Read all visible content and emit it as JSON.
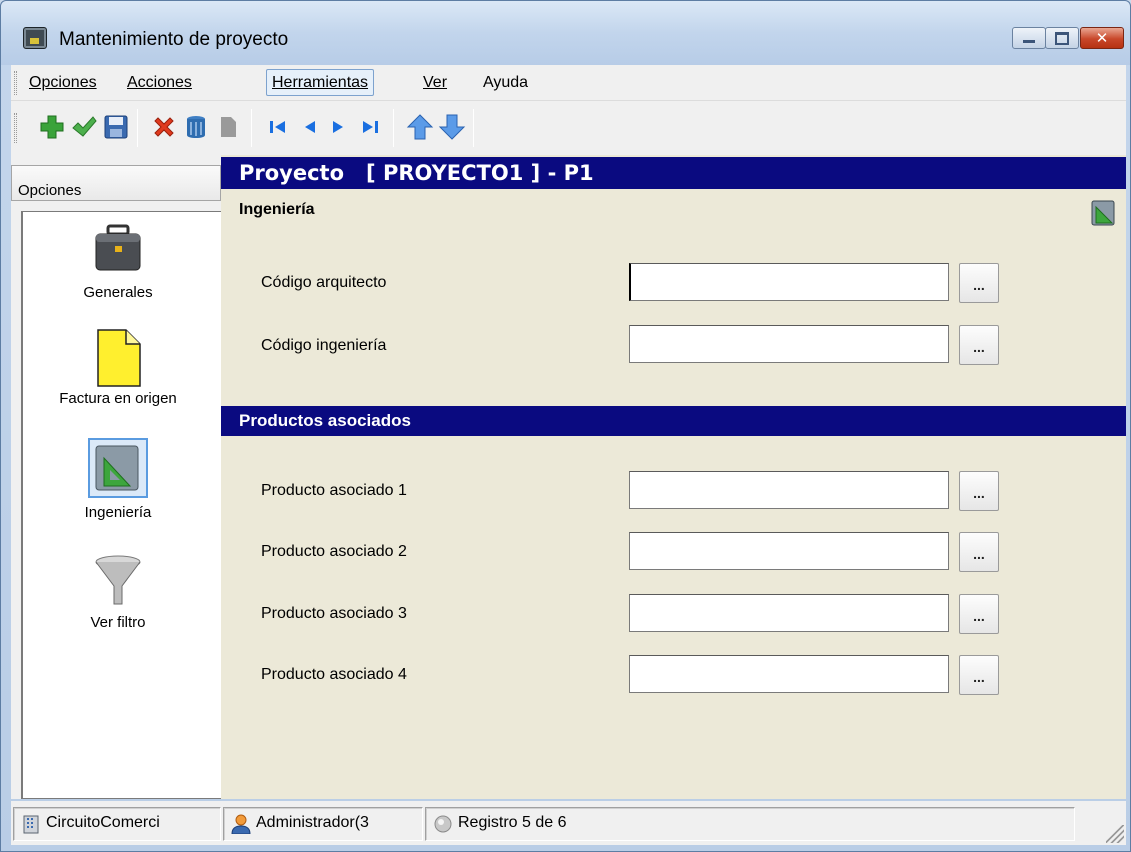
{
  "window": {
    "title": "Mantenimiento de proyecto"
  },
  "menu": {
    "items": [
      {
        "label": "Opciones"
      },
      {
        "label": "Acciones"
      },
      {
        "label": "Herramientas",
        "active": true
      },
      {
        "label": "Ver"
      },
      {
        "label": "Ayuda"
      }
    ]
  },
  "toolbar": {
    "buttons": [
      {
        "icon": "add-icon"
      },
      {
        "icon": "check-icon"
      },
      {
        "icon": "save-icon"
      },
      {
        "icon": "delete-icon"
      },
      {
        "icon": "trash-icon"
      },
      {
        "icon": "disabled-icon"
      },
      {
        "icon": "first-record-icon"
      },
      {
        "icon": "previous-record-icon"
      },
      {
        "icon": "next-record-icon"
      },
      {
        "icon": "last-record-icon"
      },
      {
        "icon": "move-up-icon"
      },
      {
        "icon": "move-down-icon"
      }
    ]
  },
  "sidebar": {
    "header": "Opciones",
    "items": [
      {
        "label": "Generales",
        "icon": "briefcase-icon"
      },
      {
        "label": "Factura en origen",
        "icon": "document-icon"
      },
      {
        "label": "Ingeniería",
        "icon": "engineering-icon",
        "selected": true
      },
      {
        "label": "Ver filtro",
        "icon": "funnel-icon"
      }
    ]
  },
  "content": {
    "header_prefix": "Proyecto",
    "header_code": "[ PROYECTO1 ] - P1",
    "section_title": "Ingeniería",
    "fields": [
      {
        "label": "Código arquitecto",
        "value": ""
      },
      {
        "label": "Código ingeniería",
        "value": ""
      }
    ],
    "products_title": "Productos asociados",
    "products": [
      {
        "label": "Producto asociado 1",
        "value": ""
      },
      {
        "label": "Producto asociado 2",
        "value": ""
      },
      {
        "label": "Producto asociado 3",
        "value": ""
      },
      {
        "label": "Producto asociado 4",
        "value": ""
      }
    ],
    "lookup_label": "..."
  },
  "statusbar": {
    "company": "CircuitoComerci",
    "user": "Administrador(3",
    "record": "Registro 5 de 6"
  },
  "colors": {
    "header_bg": "#0a0a80",
    "content_bg": "#ece9d8"
  }
}
